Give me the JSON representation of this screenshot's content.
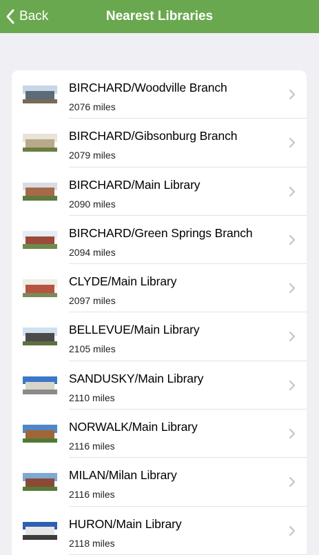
{
  "nav": {
    "back_label": "Back",
    "title": "Nearest Libraries",
    "bar_color": "#6aa84f"
  },
  "libraries": [
    {
      "name": "BIRCHARD/Woodville Branch",
      "distance": "2076 miles",
      "icon": "library-photo",
      "sky": "#c9d6e6",
      "bldg": "#5b6b7a",
      "ground": "#7a6a55"
    },
    {
      "name": "BIRCHARD/Gibsonburg Branch",
      "distance": "2079 miles",
      "icon": "library-photo",
      "sky": "#e8e4da",
      "bldg": "#b8a98a",
      "ground": "#6b7d3f"
    },
    {
      "name": "BIRCHARD/Main Library",
      "distance": "2090 miles",
      "icon": "library-photo",
      "sky": "#d8dde3",
      "bldg": "#a56a4a",
      "ground": "#5f7a3c"
    },
    {
      "name": "BIRCHARD/Green Springs Branch",
      "distance": "2094 miles",
      "icon": "library-photo",
      "sky": "#e6ecf2",
      "bldg": "#9b4a3c",
      "ground": "#6f8a4a"
    },
    {
      "name": "CLYDE/Main Library",
      "distance": "2097 miles",
      "icon": "library-photo",
      "sky": "#f0ede6",
      "bldg": "#b5553f",
      "ground": "#7c8a5a"
    },
    {
      "name": "BELLEVUE/Main Library",
      "distance": "2105 miles",
      "icon": "library-photo",
      "sky": "#cfe0f0",
      "bldg": "#4a4a4a",
      "ground": "#5f7040"
    },
    {
      "name": "SANDUSKY/Main Library",
      "distance": "2110 miles",
      "icon": "library-photo",
      "sky": "#3d78c8",
      "bldg": "#d9d4cc",
      "ground": "#8a8a8a"
    },
    {
      "name": "NORWALK/Main Library",
      "distance": "2116 miles",
      "icon": "library-photo",
      "sky": "#4f86c6",
      "bldg": "#a0663a",
      "ground": "#4f7a35"
    },
    {
      "name": "MILAN/Milan Library",
      "distance": "2116 miles",
      "icon": "library-photo",
      "sky": "#7fa8d4",
      "bldg": "#8a4a34",
      "ground": "#5a7a3a"
    },
    {
      "name": "HURON/Main Library",
      "distance": "2118 miles",
      "icon": "library-photo",
      "sky": "#2e5fb0",
      "bldg": "#e6e6e6",
      "ground": "#3c3c3c"
    }
  ]
}
